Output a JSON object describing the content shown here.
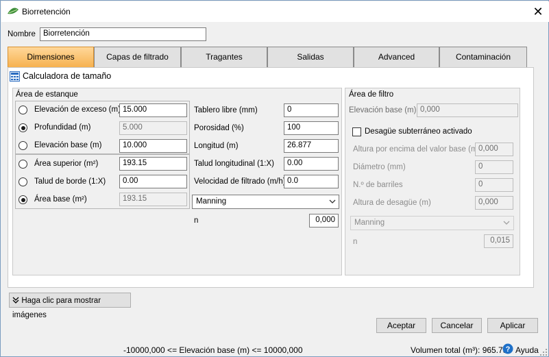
{
  "window": {
    "title": "Biorretención",
    "close_glyph": "✕"
  },
  "nombre": {
    "label": "Nombre",
    "value": "Biorretención"
  },
  "tabs": [
    {
      "label": "Dimensiones",
      "active": true
    },
    {
      "label": "Capas de filtrado"
    },
    {
      "label": "Tragantes"
    },
    {
      "label": "Salidas"
    },
    {
      "label": "Advanced"
    },
    {
      "label": "Contaminación"
    }
  ],
  "calc_link": "Calculadora de tamaño",
  "area_estanque": {
    "title": "Área de estanque",
    "rows": [
      {
        "label": "Elevación de exceso (m)",
        "value": "15.000",
        "selected": false,
        "disabled": false
      },
      {
        "label": "Profundidad (m)",
        "value": "5.000",
        "selected": true,
        "disabled": true
      },
      {
        "label": "Elevación base (m)",
        "value": "10.000",
        "selected": false,
        "disabled": false
      },
      {
        "label": "Área superior (m²)",
        "value": "193.15",
        "selected": false,
        "disabled": false
      },
      {
        "label": "Talud de borde (1:X)",
        "value": "0.00",
        "selected": false,
        "disabled": false
      },
      {
        "label": "Área base (m²)",
        "value": "193.15",
        "selected": true,
        "disabled": true
      }
    ],
    "right": [
      {
        "label": "Tablero libre (mm)",
        "value": "0"
      },
      {
        "label": "Porosidad (%)",
        "value": "100"
      },
      {
        "label": "Longitud (m)",
        "value": "26.877"
      },
      {
        "label": "Talud longitudinal (1:X)",
        "value": "0.00"
      },
      {
        "label": "Velocidad de filtrado (m/h)",
        "value": "0.0"
      }
    ],
    "manning": {
      "selected": "Manning",
      "n_label": "n",
      "n_value": "0,000"
    }
  },
  "area_filtro": {
    "title": "Área de filtro",
    "elev_label": "Elevación base (m)",
    "elev_value": "0,000",
    "checkbox_label": "Desagüe subterráneo activado",
    "checked": false,
    "fields": [
      {
        "label": "Altura por encima del valor base (m)",
        "value": "0,000"
      },
      {
        "label": "Diámetro (mm)",
        "value": "0"
      },
      {
        "label": "N.º de barriles",
        "value": "0"
      },
      {
        "label": "Altura de desagüe (m)",
        "value": "0,000"
      }
    ],
    "manning": {
      "selected": "Manning",
      "n_label": "n",
      "n_value": "0,015"
    }
  },
  "show_images": "Haga clic para mostrar imágenes",
  "buttons": {
    "accept": "Aceptar",
    "cancel": "Cancelar",
    "apply": "Aplicar"
  },
  "status": {
    "range": "-10000,000 <= Elevación base (m) <= 10000,000",
    "volume": "Volumen total (m³): 965.750",
    "help": "Ayuda"
  },
  "colors": {
    "active_tab": "#f6b14f",
    "accent": "#1e70c8"
  }
}
